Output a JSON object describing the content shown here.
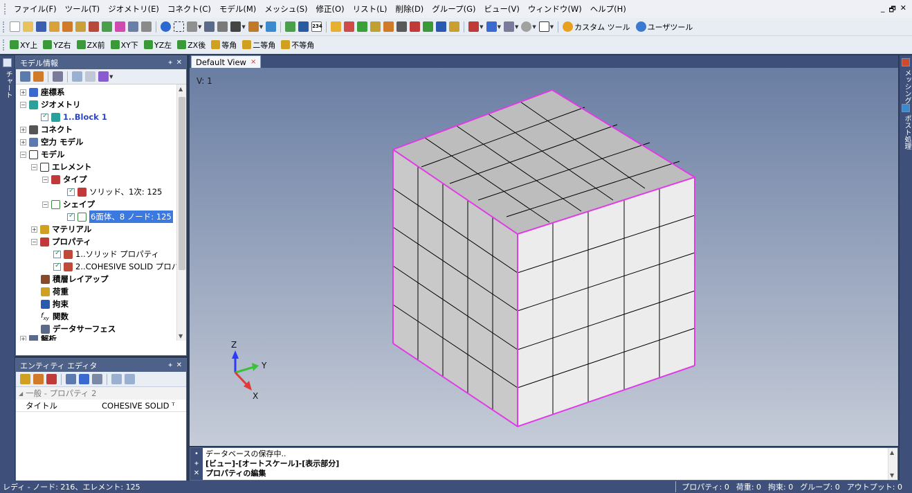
{
  "menu": [
    "ファイル(F)",
    "ツール(T)",
    "ジオメトリ(E)",
    "コネクト(C)",
    "モデル(M)",
    "メッシュ(S)",
    "修正(O)",
    "リスト(L)",
    "削除(D)",
    "グループ(G)",
    "ビュー(V)",
    "ウィンドウ(W)",
    "ヘルプ(H)"
  ],
  "window_buttons": {
    "minimize": "_",
    "restore": "🗗",
    "close": "✕"
  },
  "toolbar": {
    "custom_tools": "カスタム ツール",
    "user_tools": "ユーザツール",
    "badge_234": "234"
  },
  "view_toolbar": [
    "XY上",
    "YZ右",
    "ZX前",
    "XY下",
    "YZ左",
    "ZX後",
    "等角",
    "二等角",
    "不等角"
  ],
  "left_strip_label": "チャート",
  "right_strip_labels": [
    "メッシング",
    "ポスト処理"
  ],
  "model_panel": {
    "title": "モデル情報",
    "pin": "ᚐ",
    "close": "✕",
    "tree": {
      "coord": "座標系",
      "geometry": "ジオメトリ",
      "block": "1..Block 1",
      "connect": "コネクト",
      "aero": "空力 モデル",
      "model": "モデル",
      "element": "エレメント",
      "type": "タイプ",
      "solid_type": "ソリッド、1次: 125",
      "shape": "シェイプ",
      "hexa": "6面体、8 ノード: 125",
      "material": "マテリアル",
      "property": "プロパティ",
      "prop1": "1..ソリッド プロパティ",
      "prop2": "2..COHESIVE SOLID プロパ",
      "layup": "積層レイアップ",
      "load": "荷重",
      "constraint": "拘束",
      "func_prefix": "f",
      "func_sub": "xy",
      "function": "関数",
      "data_surface": "データサーフェス",
      "analysis": "解析"
    }
  },
  "entity_panel": {
    "title": "エンティティ エディタ",
    "category": "一般 - プロパティ 2",
    "row_label": "タイトル",
    "row_value": "COHESIVE SOLID ᵀ"
  },
  "view": {
    "tab": "Default View",
    "tab_close": "×",
    "label": "V: 1",
    "axes": {
      "z": "Z",
      "y": "Y",
      "x": "X"
    }
  },
  "output": {
    "lines": [
      "データベースの保存中..",
      "[ビュー]-[オートスケール]-[表示部分]",
      "プロパティの編集"
    ],
    "side": [
      "•",
      "ᚐ",
      "✕"
    ]
  },
  "status": {
    "left": "レディ - ノード: 216、エレメント: 125",
    "right": [
      "プロパティ: 0",
      "荷重: 0",
      "拘束: 0",
      "グループ: 0",
      "アウトプット: 0"
    ]
  },
  "colors": {
    "accent": "#4d6189",
    "cube_edge": "#e03ce6",
    "face_top": "#bdbdbd",
    "face_left": "#c9c9c9",
    "face_right": "#ececec"
  }
}
